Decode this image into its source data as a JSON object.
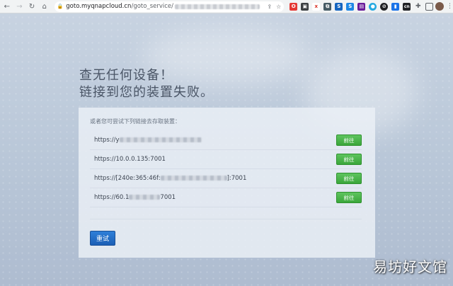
{
  "browser": {
    "url_host": "goto.myqnapcloud.cn",
    "url_path": "/goto_service/",
    "extensions": [
      {
        "label": "O",
        "color": "#e53935"
      },
      {
        "label": "▣",
        "color": "#3c4043"
      },
      {
        "label": "x",
        "color": "#ffffff"
      },
      {
        "label": "⧉",
        "color": "#455a64"
      },
      {
        "label": "S",
        "color": "#1565c0"
      },
      {
        "label": "S",
        "color": "#1e88e5"
      },
      {
        "label": "▤",
        "color": "#6a1b9a"
      },
      {
        "label": "●",
        "color": "#26a9e0"
      },
      {
        "label": "⊘",
        "color": "#202124"
      },
      {
        "label": "▮",
        "color": "#1a73e8"
      },
      {
        "label": "cn",
        "color": "#202124"
      }
    ]
  },
  "page": {
    "title_line1": "查无任何设备！",
    "title_line2": "链接到您的装置失败。",
    "hint": "或者您可尝试下列链接去存取装置：",
    "links": [
      {
        "prefix": "https://y",
        "suffix": ""
      },
      {
        "prefix": "https://10.0.0.135:7001",
        "suffix": ""
      },
      {
        "prefix": "https://[240e:365:46f:",
        "suffix": "]:7001"
      },
      {
        "prefix": "https://60.1",
        "suffix": "7001"
      }
    ],
    "go_label": "前往",
    "retry_label": "重试"
  },
  "watermark": "易坊好文馆"
}
